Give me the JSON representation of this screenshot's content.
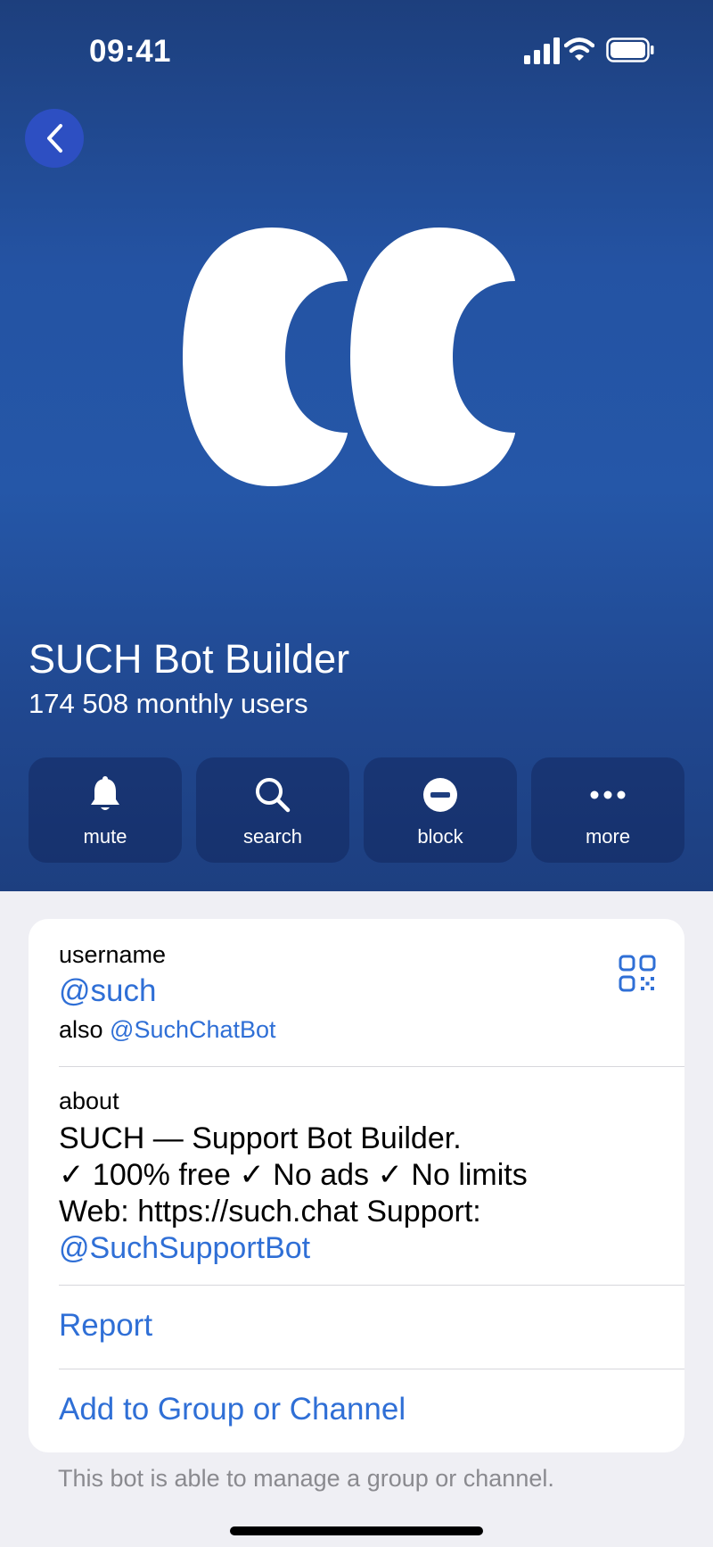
{
  "status_bar": {
    "time": "09:41"
  },
  "profile": {
    "name": "SUCH Bot Builder",
    "subtitle": "174 508 monthly users"
  },
  "actions": [
    {
      "label": "mute",
      "icon": "bell-icon"
    },
    {
      "label": "search",
      "icon": "search-icon"
    },
    {
      "label": "block",
      "icon": "block-icon"
    },
    {
      "label": "more",
      "icon": "more-icon"
    }
  ],
  "info": {
    "username_caption": "username",
    "username": "@such",
    "also_prefix": "also",
    "also_username": "@SuchChatBot",
    "about_caption": "about",
    "about_lines": [
      "SUCH — Support Bot Builder.",
      "✓ 100% free ✓ No ads ✓ No limits",
      "Web: https://such.chat Support:"
    ],
    "about_link": "@SuchSupportBot",
    "report_label": "Report",
    "add_label": "Add to Group or Channel"
  },
  "footer_note": "This bot is able to manage a group or channel.",
  "colors": {
    "accent": "#2f6fd6",
    "hero_background": "#2557a8",
    "back_button": "#2d4fc2"
  }
}
